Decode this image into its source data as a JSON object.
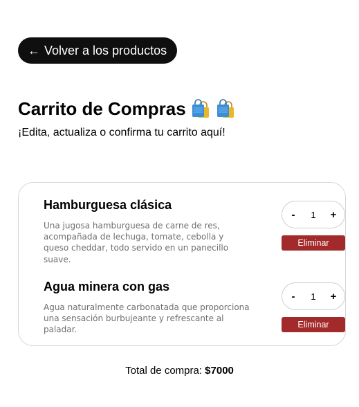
{
  "back_button": {
    "arrow": "←",
    "label": "Volver a los productos"
  },
  "header": {
    "title": "Carrito de Compras",
    "title_icons": [
      "shopping-bags-icon",
      "shopping-bags-icon"
    ],
    "subtitle": "¡Edita, actualiza o confirma tu carrito aquí!"
  },
  "cart": {
    "items": [
      {
        "name": "Hamburguesa clásica",
        "description": "Una jugosa hamburguesa de carne de res, acompañada de lechuga, tomate, cebolla y queso cheddar, todo servido en un panecillo suave.",
        "quantity": "1",
        "decrement_label": "-",
        "increment_label": "+",
        "delete_label": "Eliminar"
      },
      {
        "name": "Agua minera con gas",
        "description": "Agua naturalmente carbonatada que proporciona una sensación burbujeante y refrescante al paladar.",
        "quantity": "1",
        "decrement_label": "-",
        "increment_label": "+",
        "delete_label": "Eliminar"
      }
    ]
  },
  "total": {
    "label": "Total de compra:",
    "value": "$7000"
  },
  "colors": {
    "button_dark": "#0f0f0f",
    "delete_red": "#a32a2a",
    "muted_text": "#6e6e6e"
  }
}
